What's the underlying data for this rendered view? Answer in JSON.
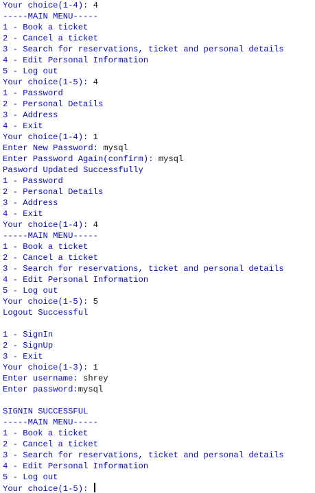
{
  "colors": {
    "output_text": "#0b0bbb",
    "input_text": "#111111",
    "background": "#ffffff"
  },
  "lines": [
    {
      "out": "Your choice(1-4): ",
      "in": "4"
    },
    {
      "out": "-----MAIN MENU-----"
    },
    {
      "out": "1 - Book a ticket"
    },
    {
      "out": "2 - Cancel a ticket"
    },
    {
      "out": "3 - Search for reservations, ticket and personal details"
    },
    {
      "out": "4 - Edit Personal Information"
    },
    {
      "out": "5 - Log out"
    },
    {
      "out": "Your choice(1-5): ",
      "in": "4"
    },
    {
      "out": "1 - Password"
    },
    {
      "out": "2 - Personal Details"
    },
    {
      "out": "3 - Address"
    },
    {
      "out": "4 - Exit"
    },
    {
      "out": "Your choice(1-4): ",
      "in": "1"
    },
    {
      "out": "Enter New Password: ",
      "in": "mysql"
    },
    {
      "out": "Enter Password Again(confirm): ",
      "in": "mysql"
    },
    {
      "out": "Pasword Updated Successfully"
    },
    {
      "out": "1 - Password"
    },
    {
      "out": "2 - Personal Details"
    },
    {
      "out": "3 - Address"
    },
    {
      "out": "4 - Exit"
    },
    {
      "out": "Your choice(1-4): ",
      "in": "4"
    },
    {
      "out": "-----MAIN MENU-----"
    },
    {
      "out": "1 - Book a ticket"
    },
    {
      "out": "2 - Cancel a ticket"
    },
    {
      "out": "3 - Search for reservations, ticket and personal details"
    },
    {
      "out": "4 - Edit Personal Information"
    },
    {
      "out": "5 - Log out"
    },
    {
      "out": "Your choice(1-5): ",
      "in": "5"
    },
    {
      "out": "Logout Successful"
    },
    {
      "out": ""
    },
    {
      "out": "1 - SignIn"
    },
    {
      "out": "2 - SignUp"
    },
    {
      "out": "3 - Exit"
    },
    {
      "out": "Your choice(1-3): ",
      "in": "1"
    },
    {
      "out": "Enter username: ",
      "in": "shrey"
    },
    {
      "out": "Enter password:",
      "in": "mysql"
    },
    {
      "out": ""
    },
    {
      "out": "SIGNIN SUCCESSFUL"
    },
    {
      "out": "-----MAIN MENU-----"
    },
    {
      "out": "1 - Book a ticket"
    },
    {
      "out": "2 - Cancel a ticket"
    },
    {
      "out": "3 - Search for reservations, ticket and personal details"
    },
    {
      "out": "4 - Edit Personal Information"
    },
    {
      "out": "5 - Log out"
    },
    {
      "out": "Your choice(1-5): ",
      "in": "",
      "cursor": true
    }
  ]
}
